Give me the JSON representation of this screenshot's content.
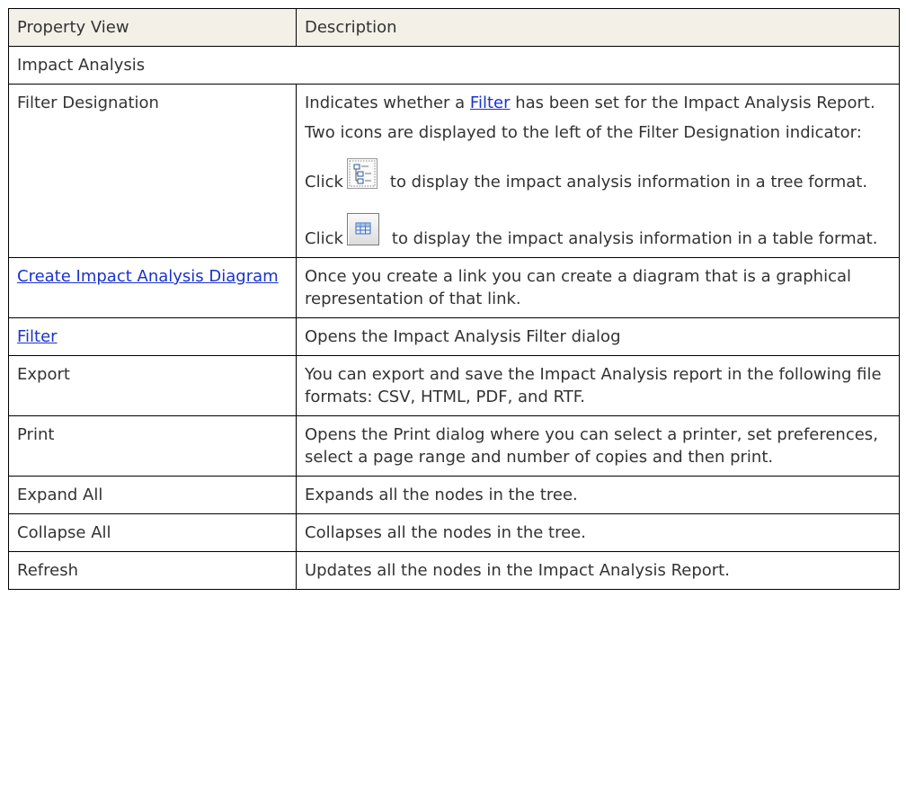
{
  "header": {
    "col1": "Property  View",
    "col2": "Description"
  },
  "section": {
    "title": "Impact Analysis"
  },
  "filter_designation": {
    "property": "Filter Designation",
    "desc1_before": "Indicates whether a ",
    "desc1_link": "Filter",
    "desc1_after": " has been set for the Impact Analysis Report.",
    "desc2": "Two icons are displayed to the left of the Filter Designation indicator:",
    "click_label": "Click",
    "tree_text": "to display the impact analysis information in a tree format.",
    "table_text": "to display the impact analysis information in a table format.",
    "tree_icon": "tree-view-icon",
    "table_icon": "table-view-icon"
  },
  "rows": [
    {
      "property": "Create Impact Analysis Diagram",
      "is_link": true,
      "description": "Once you create a link you can create a diagram that is a graphical representation of that link."
    },
    {
      "property": "Filter",
      "is_link": true,
      "description": "Opens the Impact Analysis Filter dialog"
    },
    {
      "property": "Export",
      "is_link": false,
      "description": "You can export and save the Impact Analysis report in the following file formats: CSV, HTML, PDF, and RTF."
    },
    {
      "property": "Print",
      "is_link": false,
      "description": "Opens the Print dialog where you can select a printer, set preferences, select a page range and number of copies and then print."
    },
    {
      "property": "Expand All",
      "is_link": false,
      "description": "Expands all the nodes in the tree."
    },
    {
      "property": "Collapse All",
      "is_link": false,
      "description": "Collapses all the nodes in the tree."
    },
    {
      "property": "Refresh",
      "is_link": false,
      "description": "Updates all the nodes in the Impact Analysis Report."
    }
  ],
  "colors": {
    "header_bg": "#f3f0e8",
    "link": "#1a33cc",
    "text": "#333333",
    "border": "#000000"
  }
}
